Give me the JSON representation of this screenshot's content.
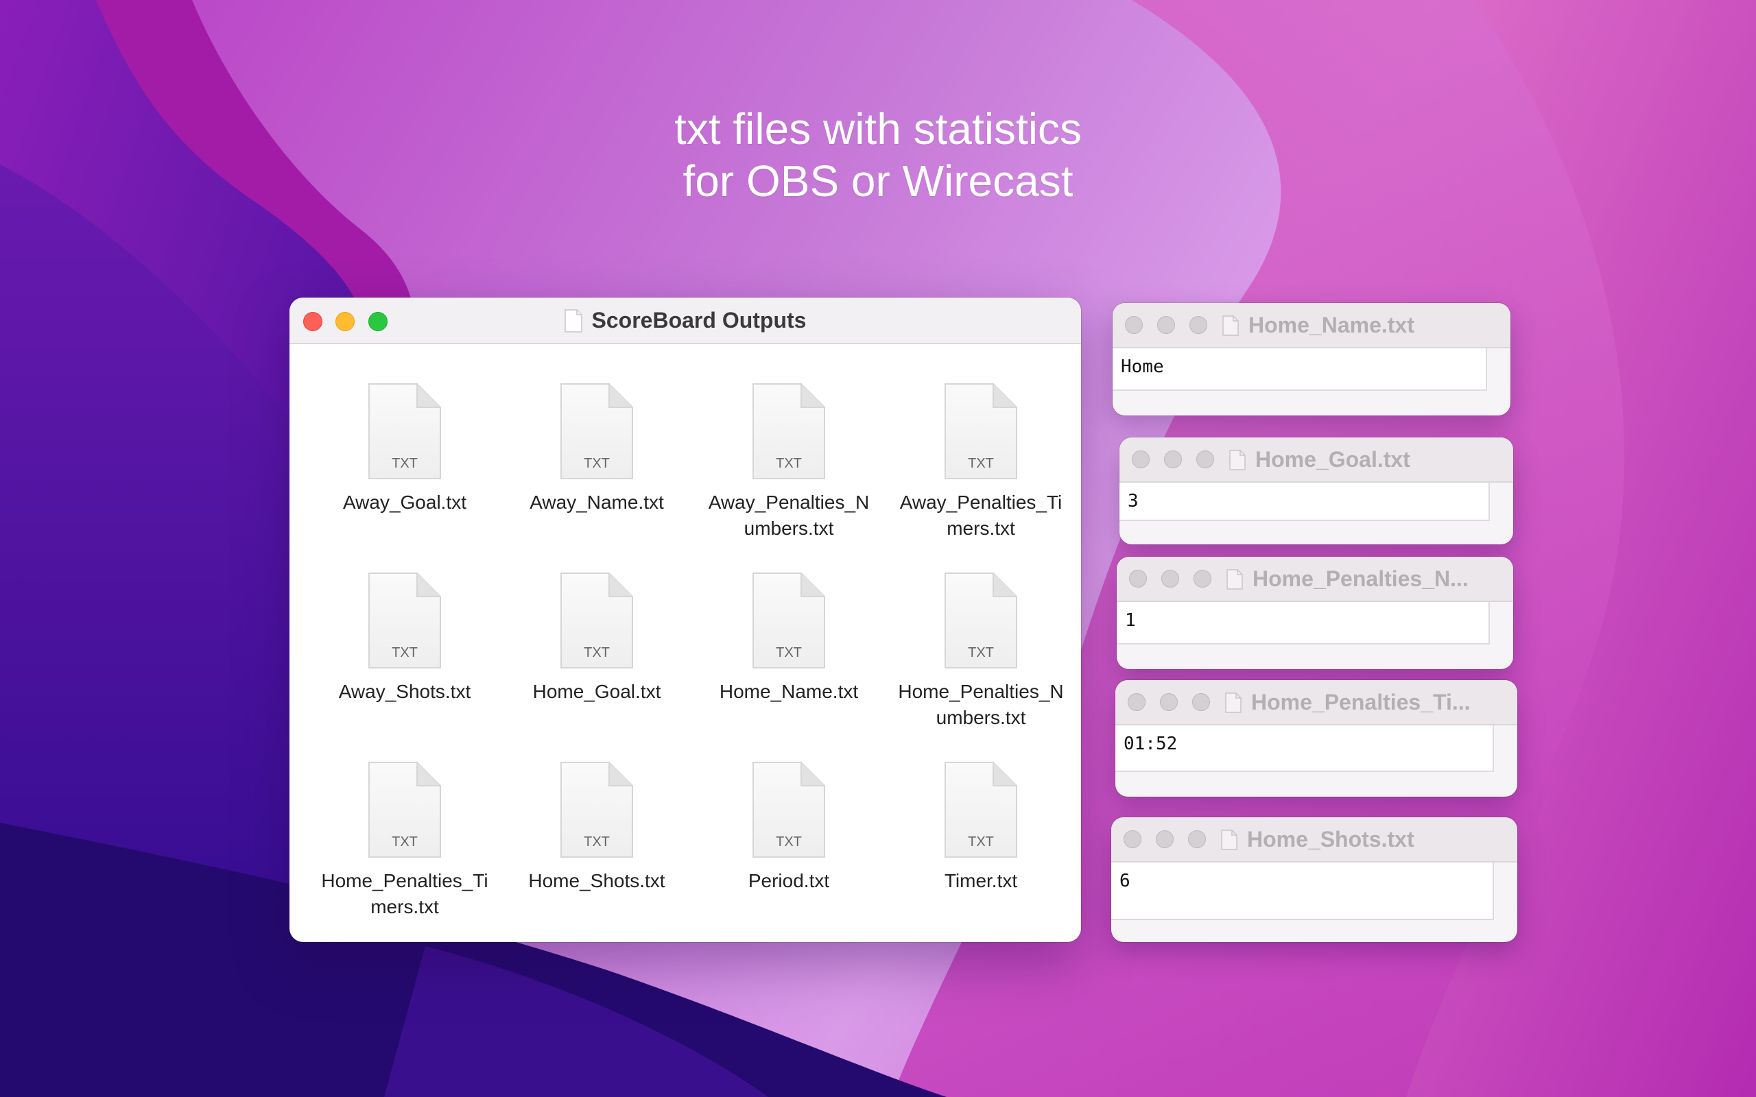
{
  "headline": {
    "line1": "txt files with statistics",
    "line2": "for OBS or Wirecast"
  },
  "finder": {
    "title": "ScoreBoard Outputs",
    "icon_badge": "TXT",
    "files": [
      "Away_Goal.txt",
      "Away_Name.txt",
      "Away_Penalties_Numbers.txt",
      "Away_Penalties_Timers.txt",
      "Away_Shots.txt",
      "Home_Goal.txt",
      "Home_Name.txt",
      "Home_Penalties_Numbers.txt",
      "Home_Penalties_Timers.txt",
      "Home_Shots.txt",
      "Period.txt",
      "Timer.txt"
    ]
  },
  "text_windows": [
    {
      "title": "Home_Name.txt",
      "content": "Home"
    },
    {
      "title": "Home_Goal.txt",
      "content": "3"
    },
    {
      "title": "Home_Penalties_N...",
      "content": "1"
    },
    {
      "title": "Home_Penalties_Ti...",
      "content": "01:52"
    },
    {
      "title": "Home_Shots.txt",
      "content": "6"
    }
  ],
  "colors": {
    "close": "#fe5f57",
    "minimize": "#febc2e",
    "zoom": "#28c840"
  },
  "icons": {
    "document": "document-icon",
    "txt_file": "txt-file-icon"
  }
}
